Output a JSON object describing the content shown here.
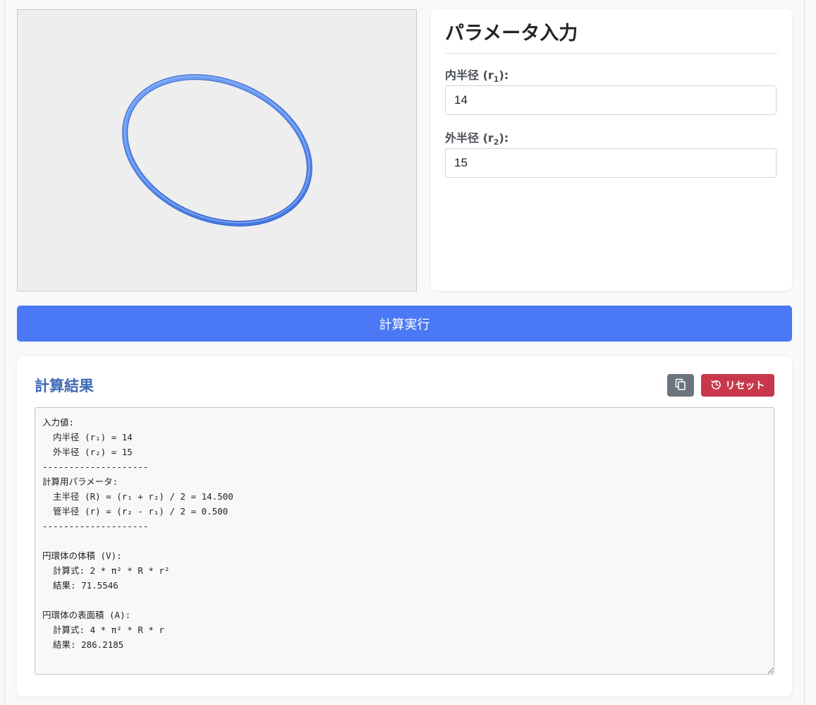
{
  "viewer": {
    "background": "#eeeeee",
    "torus_color": "#5b8ef0"
  },
  "params": {
    "title": "パラメータ入力",
    "inner_radius": {
      "label_prefix": "内半径 (r",
      "label_sub": "1",
      "label_suffix": "):",
      "value": "14"
    },
    "outer_radius": {
      "label_prefix": "外半径 (r",
      "label_sub": "2",
      "label_suffix": "):",
      "value": "15"
    }
  },
  "calc_button": {
    "label": "計算実行",
    "color": "#4b78f5"
  },
  "results": {
    "title": "計算結果",
    "copy_icon": "copy-icon",
    "reset_icon": "history-icon",
    "reset_label": "リセット",
    "text": "入力値:\n  内半径 (r₁) = 14\n  外半径 (r₂) = 15\n--------------------\n計算用パラメータ:\n  主半径 (R) = (r₁ + r₂) / 2 = 14.500\n  管半径 (r) = (r₂ - r₁) / 2 = 0.500\n--------------------\n\n円環体の体積 (V):\n  計算式: 2 * π² * R * r²\n  結果: 71.5546\n\n円環体の表面積 (A):\n  計算式: 4 * π² * R * r\n  結果: 286.2185"
  }
}
